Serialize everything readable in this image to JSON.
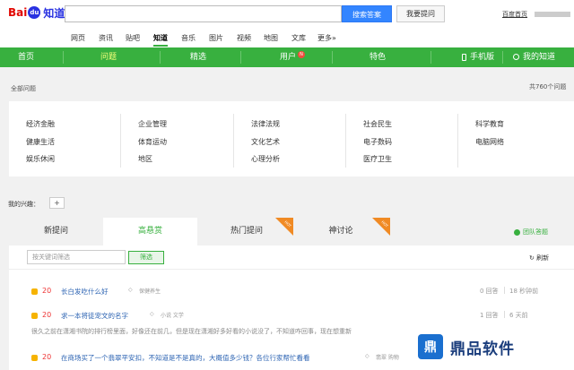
{
  "header": {
    "logo_bai": "Bai",
    "logo_paw": "du",
    "logo_zhidao": "知道",
    "search_button": "搜索答案",
    "ask_button": "我要提问",
    "home_link": "百度首页"
  },
  "subnav": [
    {
      "label": "网页"
    },
    {
      "label": "资讯"
    },
    {
      "label": "贴吧"
    },
    {
      "label": "知道"
    },
    {
      "label": "音乐"
    },
    {
      "label": "图片"
    },
    {
      "label": "视频"
    },
    {
      "label": "地图"
    },
    {
      "label": "文库"
    },
    {
      "label": "更多»"
    }
  ],
  "green_nav": {
    "home": "首页",
    "questions": "问题",
    "featured": "精选",
    "users": "用户",
    "users_badge": "N",
    "special": "特色",
    "mobile": "手机版",
    "my_zhidao": "我的知道"
  },
  "categories_header": {
    "all": "全部问题",
    "count": "共760个问题"
  },
  "categories": [
    [
      "经济金融",
      "健康生活",
      "娱乐休闲"
    ],
    [
      "企业管理",
      "体育运动",
      "地区"
    ],
    [
      "法律法规",
      "文化艺术",
      "心理分析"
    ],
    [
      "社会民生",
      "电子数码",
      "医疗卫生"
    ],
    [
      "科学教育",
      "电脑网络"
    ]
  ],
  "interest": {
    "label": "我的兴趣：",
    "add": "+"
  },
  "tabs": [
    {
      "label": "新提问"
    },
    {
      "label": "高悬赏"
    },
    {
      "label": "热门提问"
    },
    {
      "label": "神讨论"
    }
  ],
  "hot_badge": "HOT",
  "team_answer": "团队答题",
  "filter": {
    "placeholder": "按关键词筛选",
    "button": "筛选",
    "refresh": "刷新"
  },
  "questions": [
    {
      "score": "20",
      "title": "长白发吃什么好",
      "tags": "保健养生",
      "answers": "0 回答",
      "ago": "18 秒钟前"
    },
    {
      "score": "20",
      "title": "求一本将徒宠文的名字",
      "tags": "小说   文学",
      "answers": "1 回答",
      "ago": "6 天前"
    },
    {
      "score": "20",
      "title": "在商场买了一个翡翠平安扣，不知道是不是真的，大概值多少钱？各位行家帮忙看看",
      "tags": "翡翠   购物",
      "answers": "",
      "ago": ""
    }
  ],
  "snippet": "很久之前在潇湘书院的排行榜里面，好像还在前几，但是现在潇湘好多好看的小说没了，不知道咋回事，现在想重新",
  "watermark": {
    "logo": "鼎",
    "text": "鼎品软件"
  },
  "colors": {
    "green": "#38b03f",
    "blue": "#3385ff",
    "link": "#2d64b3",
    "score_red": "#e33",
    "coin": "#f6b300"
  }
}
